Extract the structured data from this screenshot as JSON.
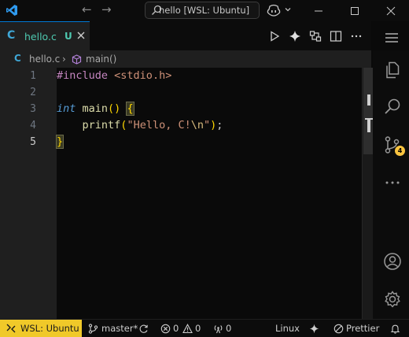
{
  "titlebar": {
    "command_center_text": "hello [WSL: Ubuntu]",
    "icons": [
      "vscode-logo",
      "arrow-left",
      "arrow-right",
      "search",
      "copilot",
      "minimize",
      "maximize",
      "close"
    ]
  },
  "tabs": [
    {
      "language_glyph": "C",
      "title": "hello.c",
      "status": "U",
      "active": true
    }
  ],
  "breadcrumb": {
    "language_glyph": "C",
    "file": "hello.c",
    "separator": "›",
    "symbol": "main()"
  },
  "editor": {
    "line_numbers": [
      "1",
      "2",
      "3",
      "4",
      "5"
    ],
    "active_line": "5",
    "lines": {
      "l1": {
        "directive": "#include",
        "space": " ",
        "header": "<stdio.h>"
      },
      "l3": {
        "keyword": "int",
        "space": " ",
        "name": "main",
        "parens": "()",
        "space2": " ",
        "brace": "{"
      },
      "l4": {
        "indent": "    ",
        "fn": "printf",
        "open": "(",
        "str1": "\"Hello, C!",
        "esc": "\\n",
        "str2": "\"",
        "close": ")",
        "semi": ";"
      },
      "l5": {
        "brace": "}"
      }
    }
  },
  "activity_bar": {
    "items": [
      "explorer-icon",
      "search-icon",
      "source-control-icon",
      "more-icon",
      "account-icon",
      "settings-icon"
    ],
    "source_control_badge": "4"
  },
  "statusbar": {
    "remote": "WSL: Ubuntu",
    "branch": "master*",
    "errors": "0",
    "warnings": "0",
    "ports": "0",
    "eol_os": "Linux",
    "formatter": "Prettier"
  },
  "colors": {
    "accent_blue": "#0078d4",
    "remote_yellow": "#f0c929",
    "badge_yellow": "#f9c440",
    "tab_text": "#4ec9b0"
  }
}
